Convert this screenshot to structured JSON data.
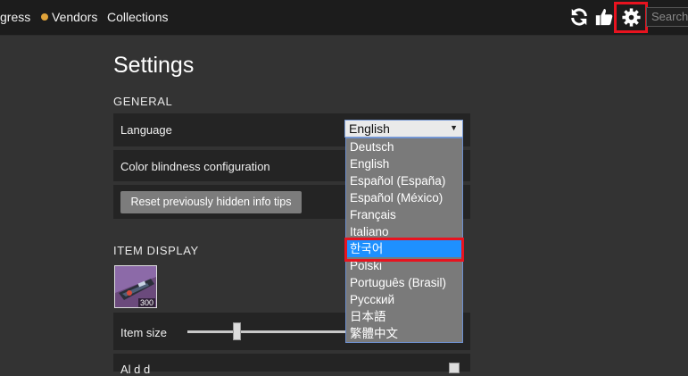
{
  "nav": {
    "progress_label": "gress",
    "vendors_label": "Vendors",
    "vendors_dot_color": "#e0a33a",
    "collections_label": "Collections"
  },
  "icons": {
    "refresh": "refresh-icon",
    "feedback": "thumbs-up-icon",
    "settings": "gear-icon"
  },
  "search": {
    "placeholder": "Search"
  },
  "page": {
    "title": "Settings"
  },
  "general": {
    "heading": "GENERAL",
    "language_label": "Language",
    "language_value": "English",
    "colorblind_label": "Color blindness configuration",
    "reset_button": "Reset previously hidden info tips"
  },
  "language_options": [
    "Deutsch",
    "English",
    "Español (España)",
    "Español (México)",
    "Français",
    "Italiano",
    "한국어",
    "Polski",
    "Português (Brasil)",
    "Русский",
    "日本語",
    "繁體中文"
  ],
  "language_highlighted": "한국어",
  "item_display": {
    "heading": "ITEM DISPLAY",
    "item_power": "300",
    "item_size_label": "Item size",
    "item_size_level": 0.31,
    "partial_row_label": "Al      d          d   "
  },
  "colors": {
    "background": "#333333",
    "topbar": "#1c1c1c",
    "row": "#242424",
    "highlight": "#e8131f",
    "selected_option": "#1e90ff"
  }
}
